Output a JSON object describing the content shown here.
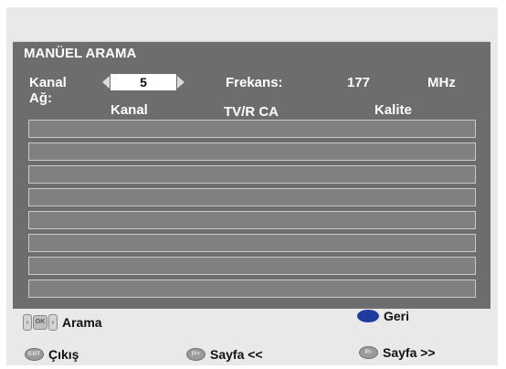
{
  "header": {
    "title": "MANÜEL ARAMA"
  },
  "fields": {
    "kanal_label": "Kanal",
    "kanal_value": "5",
    "ag_label": "Ağ:",
    "frekans_label": "Frekans:",
    "frekans_value": "177",
    "frekans_unit": "MHz"
  },
  "table": {
    "columns": [
      "Kanal",
      "TV/R CA",
      "Kalite"
    ],
    "rows": 8
  },
  "footer": {
    "search_label": "Arama",
    "back_label": "Geri",
    "exit_label": "Çıkış",
    "exit_icon_text": "EXIT",
    "page_prev_label": "Sayfa <<",
    "page_next_label": "Sayfa >>",
    "page_icon_text_prev": "P/+",
    "page_icon_text_next": "P/-",
    "nav_icon_text": "OK",
    "back_color": "#1f3d9c"
  },
  "colors": {
    "panel": "#6b6d6f",
    "row": "#7e8082",
    "screen": "#e9e9ea"
  }
}
